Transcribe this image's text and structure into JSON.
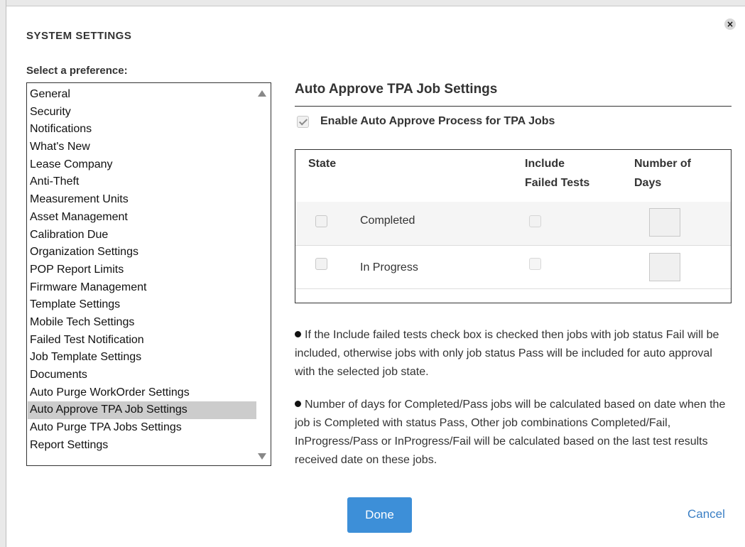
{
  "dialog": {
    "title": "SYSTEM SETTINGS",
    "close_glyph": "×"
  },
  "preferences": {
    "label": "Select a preference:",
    "items": [
      "General",
      "Security",
      "Notifications",
      "What's New",
      "Lease Company",
      "Anti-Theft",
      "Measurement Units",
      "Asset Management",
      "Calibration Due",
      "Organization Settings",
      "POP Report Limits",
      "Firmware Management",
      "Template Settings",
      "Mobile Tech Settings",
      "Failed Test Notification",
      "Job Template Settings",
      "Documents",
      "Auto Purge WorkOrder Settings",
      "Auto Approve TPA Job Settings",
      "Auto Purge TPA Jobs Settings",
      "Report Settings"
    ],
    "selected": "Auto Approve TPA Job Settings"
  },
  "settings": {
    "title": "Auto Approve TPA Job Settings",
    "enable_label": "Enable Auto Approve Process for TPA Jobs",
    "enable_checked": true,
    "table": {
      "headers": {
        "state": "State",
        "include_line1": "Include",
        "include_line2": "Failed Tests",
        "days_line1": "Number of",
        "days_line2": "Days"
      },
      "rows": [
        {
          "label": "Completed",
          "state_checked": false,
          "include_checked": false,
          "days": ""
        },
        {
          "label": "In Progress",
          "state_checked": false,
          "include_checked": false,
          "days": ""
        }
      ]
    },
    "notes": [
      "If the Include failed tests check box is checked then jobs with job status Fail will be included, otherwise jobs with only job status Pass will be included for auto approval with the selected job state.",
      "Number of days for Completed/Pass jobs will be calculated based on date when the job is Completed with status Pass, Other job combinations Completed/Fail, InProgress/Pass or InProgress/Fail will be calculated based on the last test results received date on these jobs."
    ]
  },
  "footer": {
    "done_label": "Done",
    "cancel_label": "Cancel"
  },
  "colors": {
    "primary_button": "#3d8fd8",
    "link": "#3b7fc4",
    "selected_item": "#cccccc"
  }
}
